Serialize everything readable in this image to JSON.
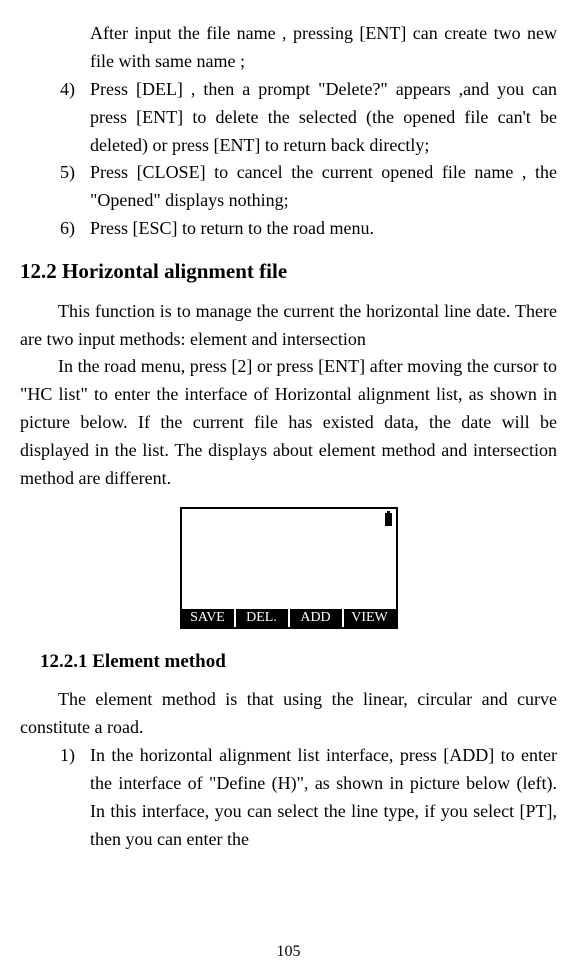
{
  "continuation_text": "After input the file name , pressing [ENT] can create two new file with same name ;",
  "items": [
    {
      "num": "4)",
      "text": "Press [DEL] , then a prompt \"Delete?\" appears ,and you can press [ENT] to delete the selected (the opened file can't be deleted) or press [ENT] to return back directly;"
    },
    {
      "num": "5)",
      "text": "Press [CLOSE] to cancel the current opened file name , the \"Opened\" displays nothing;"
    },
    {
      "num": "6)",
      "text": "Press [ESC] to return to the road menu."
    }
  ],
  "heading_12_2": "12.2 Horizontal alignment file",
  "para_12_2_a": "This function is to manage the current the horizontal line date. There are two input methods: element and intersection",
  "para_12_2_b": "In the road menu, press [2] or press [ENT] after moving the cursor to \"HC list\" to enter the interface of Horizontal alignment list, as shown  in picture below. If the current file has existed data, the date will be displayed in the list. The displays about element method and intersection method are different.",
  "device_buttons": {
    "b1": "SAVE",
    "b2": "DEL.",
    "b3": "ADD",
    "b4": "VIEW"
  },
  "heading_12_2_1": "12.2.1 Element method",
  "para_12_2_1": "The element method is that using the linear, circular and curve constitute a road.",
  "items2": [
    {
      "num": "1)",
      "text": "In the horizontal alignment list interface, press [ADD] to enter the interface of \"Define (H)\", as shown in picture below (left). In this interface, you can select the line type, if you select [PT], then you can enter the"
    }
  ],
  "page_number": "105"
}
